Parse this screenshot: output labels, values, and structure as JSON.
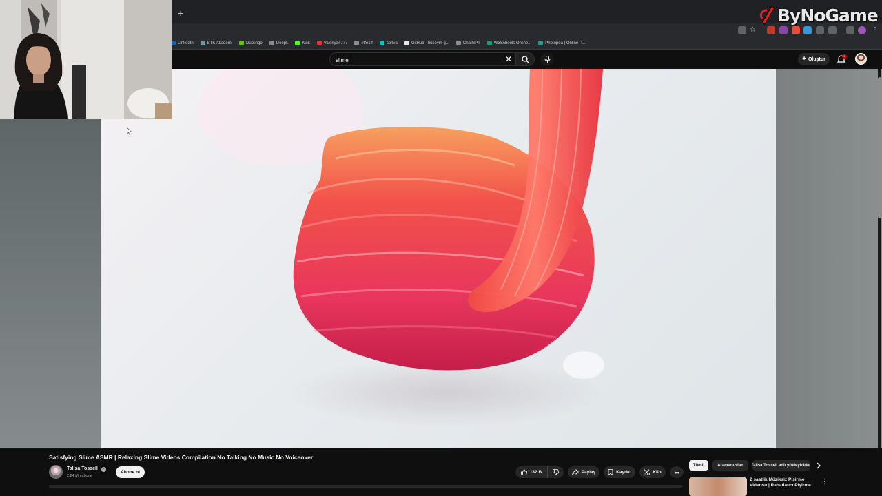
{
  "browser": {
    "new_tab": "+",
    "bookmarks": [
      {
        "label": "LinkedIn",
        "color": "#0a66c2"
      },
      {
        "label": "BTK Akademi",
        "color": "#5f9ea0"
      },
      {
        "label": "Duolingo",
        "color": "#58cc02"
      },
      {
        "label": "DeepL",
        "color": "#8a8a8a"
      },
      {
        "label": "Kick",
        "color": "#53fc18"
      },
      {
        "label": "Valeriya#777",
        "color": "#e33"
      },
      {
        "label": "#ffe1ff",
        "color": "#8e8e8e"
      },
      {
        "label": "canva",
        "color": "#00c4cc"
      },
      {
        "label": "GitHub - huseyin-g...",
        "color": "#e6e6e6"
      },
      {
        "label": "ChatGPT",
        "color": "#8a8a8a"
      },
      {
        "label": "W3Schools Online...",
        "color": "#04aa6d"
      },
      {
        "label": "Photopea | Online P...",
        "color": "#18a497"
      }
    ]
  },
  "logo": {
    "text": "ByNoGame"
  },
  "masthead": {
    "search_value": "slime",
    "create_label": "Oluştur",
    "notification_count": "1"
  },
  "video": {
    "title": "Satisfying Slime ASMR | Relaxing Slime Videos Compilation No Talking No Music No Voiceover",
    "channel_name": "Talisa Tossell",
    "subscribers": "2,24 Mn abone",
    "subscribe_label": "Abone ol",
    "likes": "132 B",
    "share_label": "Paylaş",
    "save_label": "Kaydet",
    "clip_label": "Klip"
  },
  "sidebar": {
    "chips": [
      "Tümü",
      "Aramanızdan",
      "Talisa Tossell adlı yükleyiciden"
    ],
    "recommendation_title": "2 saatlik Müziksiz Pişirme Videosu | Rahatlatıcı Pişirme"
  },
  "colors": {
    "background": "#0f0f0f",
    "accent_red": "#cc0000",
    "chip_active": "#f1f1f1"
  }
}
